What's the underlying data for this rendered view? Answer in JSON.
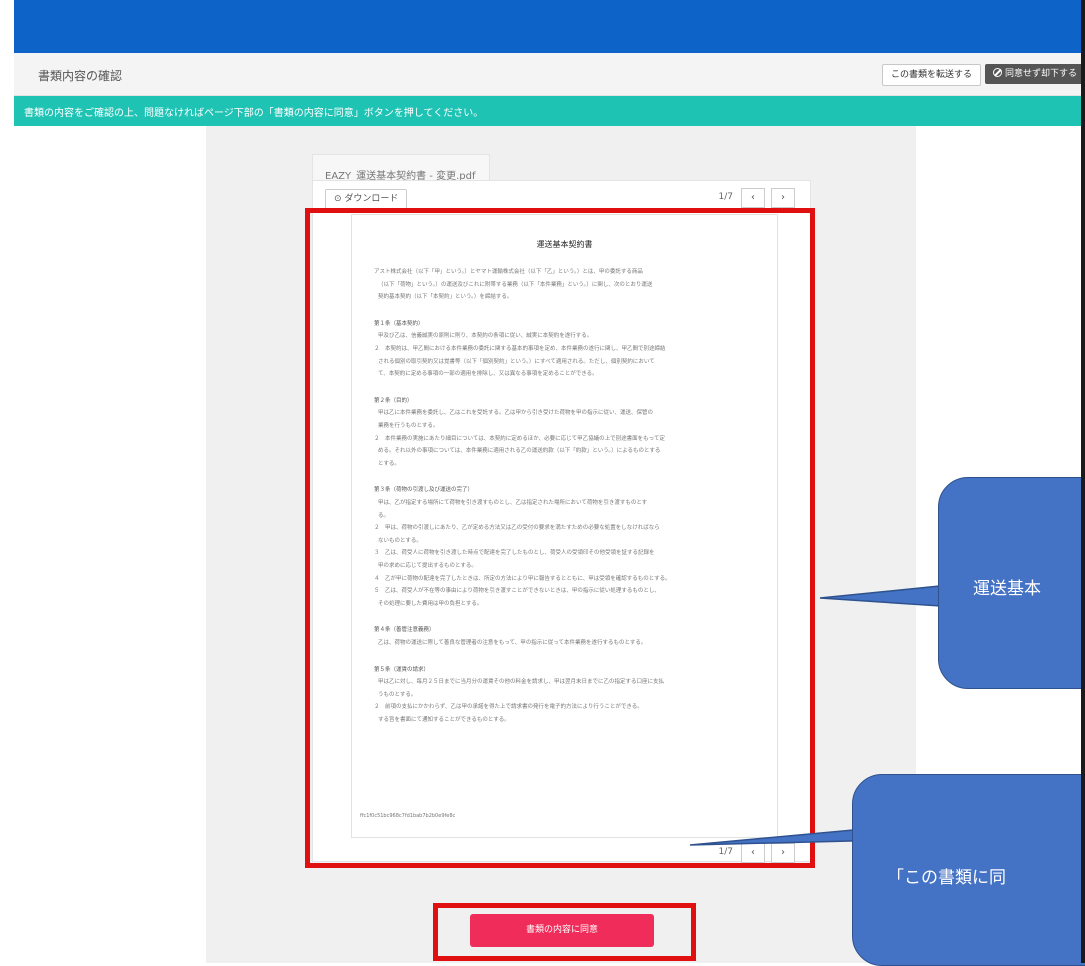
{
  "header": {
    "page_title": "書類内容の確認",
    "forward_button": "この書類を転送する",
    "decline_button": "同意せず却下する"
  },
  "notice": "書類の内容をご確認の上、問題なければページ下部の「書類の内容に同意」ボタンを押してください。",
  "viewer": {
    "file_name": "EAZY_運送基本契約書 - 変更.pdf",
    "download_label": "ダウンロード",
    "page_indicator": "1/7",
    "prev_icon": "‹",
    "next_icon": "›"
  },
  "document": {
    "title": "運送基本契約書",
    "lines": [
      "アスト株式会社（以下「甲」という。）とヤマト運輸株式会社（以下「乙」という。）とは、甲の委託する商品",
      "（以下「荷物」という。）の運送及びこれに附帯する業務（以下「本件業務」という。）に関し、次のとおり運送",
      "契約基本契約（以下「本契約」という。）を締結する。",
      "第１条（基本契約）",
      "甲及び乙は、信義誠実の原則に則り、本契約の条項に従い、誠実に本契約を遂行する。",
      "２　本契約は、甲乙間における本件業務の委託に関する基本的事項を定め、本件業務の遂行に関し、甲乙間で別途締結",
      "される個別の取引契約又は覚書等（以下「個別契約」という。）にすべて適用される。ただし、個別契約において",
      "て、本契約に定める事項の一部の適用を排除し、又は異なる事項を定めることができる。",
      "第２条（目的）",
      "甲は乙に本件業務を委託し、乙はこれを受託する。乙は甲から引き受けた荷物を甲の指示に従い、運送、保管の",
      "業務を行うものとする。",
      "２　本件業務の実施にあたり細目については、本契約に定めるほか、必要に応じて甲乙協議の上で別途書面をもって定",
      "める。それ以外の事項については、本件業務に適用される乙の運送約款（以下「約款」という。）によるものとする",
      "とする。",
      "第３条（荷物の引渡し及び運送の完了）",
      "甲は、乙が指定する場所にて荷物を引き渡すものとし、乙は指定された場所において荷物を引き渡すものとす",
      "る。",
      "２　甲は、荷物の引渡しにあたり、乙が定める方法又は乙の受付の要求を満たすための必要な処置をしなければなら",
      "ないものとする。",
      "３　乙は、荷受人に荷物を引き渡した時点で配達を完了したものとし、荷受人の受領印その他受領を証する記録を",
      "甲の求めに応じて提出するものとする。",
      "４　乙が甲に荷物の配達を完了したときは、所定の方法により甲に報告するとともに、甲は受領を確認するものとする。",
      "５　乙は、荷受人が不在等の事由により荷物を引き渡すことができないときは、甲の指示に従い処理するものとし、",
      "その処理に要した費用は甲の負担とする。",
      "第４条（善管注意義務）",
      "乙は、荷物の運送に際して善良な管理者の注意をもって、甲の指示に従って本件業務を遂行するものとする。",
      "第５条（運賃の請求）",
      "甲は乙に対し、毎月２５日までに当月分の運賃その他の料金を請求し、甲は翌月末日までに乙の指定する口座に支払",
      "うものとする。",
      "２　前項の支払にかかわらず、乙は甲の承諾を得た上で請求書の発行を電子的方法により行うことができる。",
      "する旨を書面にて通知することができるものとする。"
    ],
    "footer_hash": "ffc1f0c51bc968c7fd1bab7b2b0e9fe8c"
  },
  "agree_button": "書類の内容に同意",
  "callouts": {
    "doc": "運送基本",
    "agree": "「この書類に同"
  },
  "colors": {
    "topbar": "#0e63c8",
    "notice": "#1fc3b4",
    "agree": "#f02c5a",
    "highlight": "#e01010",
    "callout": "#4472c4"
  }
}
